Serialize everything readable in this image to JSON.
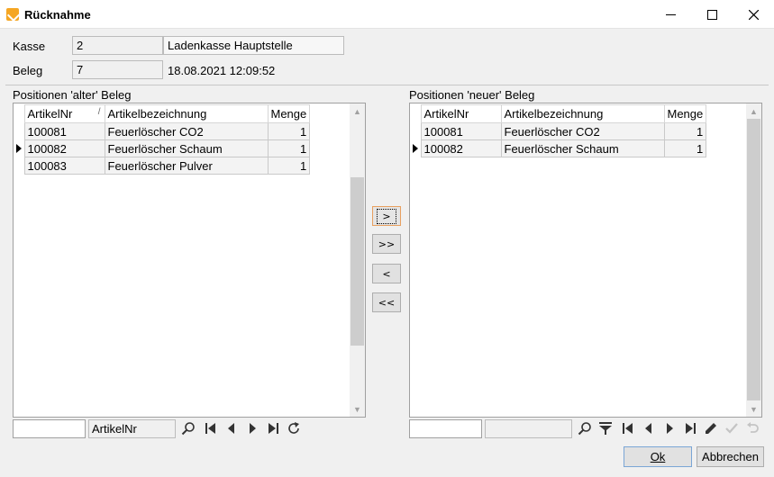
{
  "window": {
    "title": "Rücknahme"
  },
  "header": {
    "kasse_label": "Kasse",
    "kasse_nr": "2",
    "kasse_name": "Ladenkasse Hauptstelle",
    "beleg_label": "Beleg",
    "beleg_nr": "7",
    "beleg_datetime": "18.08.2021 12:09:52"
  },
  "left": {
    "title": "Positionen 'alter' Beleg",
    "columns": [
      "ArtikelNr",
      "Artikelbezeichnung",
      "Menge"
    ],
    "rows": [
      {
        "nr": "100081",
        "name": "Feuerlöscher CO2",
        "menge": "1"
      },
      {
        "nr": "100082",
        "name": "Feuerlöscher Schaum",
        "menge": "1"
      },
      {
        "nr": "100083",
        "name": "Feuerlöscher Pulver",
        "menge": "1"
      }
    ],
    "current_row": 1,
    "sort_field": "ArtikelNr",
    "search_value": ""
  },
  "right": {
    "title": "Positionen 'neuer' Beleg",
    "columns": [
      "ArtikelNr",
      "Artikelbezeichnung",
      "Menge"
    ],
    "rows": [
      {
        "nr": "100081",
        "name": "Feuerlöscher CO2",
        "menge": "1"
      },
      {
        "nr": "100082",
        "name": "Feuerlöscher Schaum",
        "menge": "1"
      }
    ],
    "current_row": 1,
    "sort_field": "",
    "search_value": ""
  },
  "transfer": {
    "move_one": ">",
    "move_all": ">>",
    "back_one": "<",
    "back_all": "<<"
  },
  "footer": {
    "ok_label": "Ok",
    "cancel_label": "Abbrechen"
  }
}
